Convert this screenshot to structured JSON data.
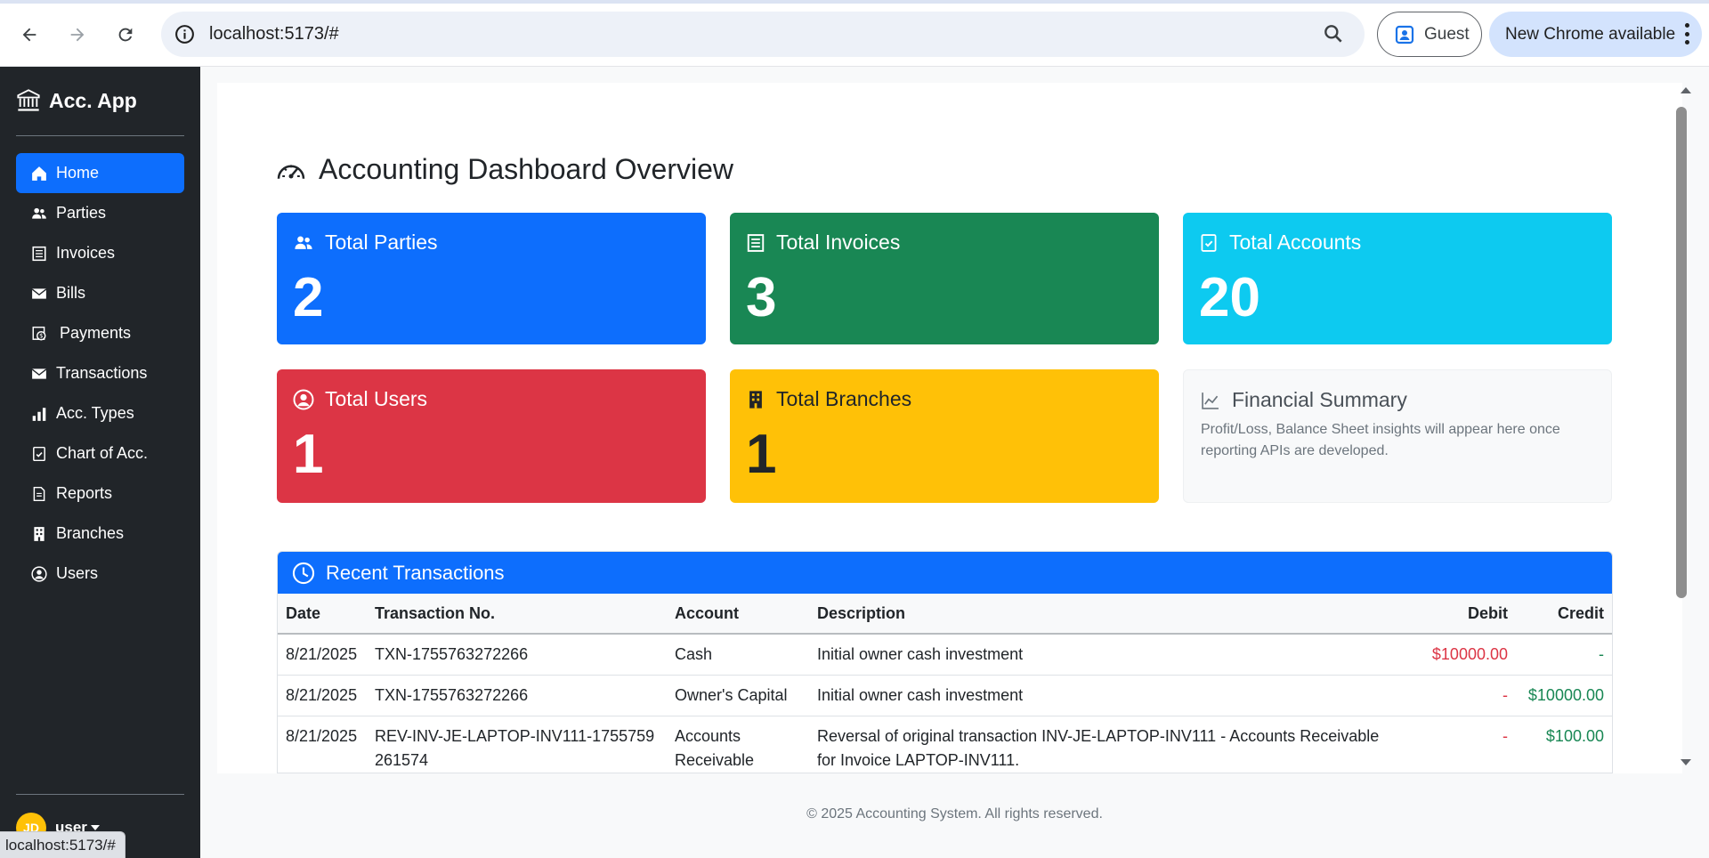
{
  "browser": {
    "url": "localhost:5173/#",
    "profile_label": "Guest",
    "update_label": "New Chrome available",
    "status_url": "localhost:5173/#"
  },
  "sidebar": {
    "brand": "Acc. App",
    "items": [
      {
        "label": "Home",
        "icon": "home-icon"
      },
      {
        "label": "Parties",
        "icon": "people-icon"
      },
      {
        "label": "Invoices",
        "icon": "invoice-icon"
      },
      {
        "label": "Bills",
        "icon": "envelope-icon"
      },
      {
        "label": "Payments",
        "icon": "cash-icon"
      },
      {
        "label": "Transactions",
        "icon": "envelope-icon"
      },
      {
        "label": "Acc. Types",
        "icon": "bar-chart-icon"
      },
      {
        "label": "Chart of Acc.",
        "icon": "journal-check-icon"
      },
      {
        "label": "Reports",
        "icon": "document-icon"
      },
      {
        "label": "Branches",
        "icon": "building-icon"
      },
      {
        "label": "Users",
        "icon": "user-circle-icon"
      }
    ],
    "user_initials": "JD",
    "user_name": "user"
  },
  "dashboard": {
    "title": "Accounting Dashboard Overview",
    "cards": {
      "parties": {
        "label": "Total Parties",
        "value": "2"
      },
      "invoices": {
        "label": "Total Invoices",
        "value": "3"
      },
      "accounts": {
        "label": "Total Accounts",
        "value": "20"
      },
      "users": {
        "label": "Total Users",
        "value": "1"
      },
      "branches": {
        "label": "Total Branches",
        "value": "1"
      },
      "summary": {
        "label": "Financial Summary",
        "text": "Profit/Loss, Balance Sheet insights will appear here once reporting APIs are developed."
      }
    },
    "recent": {
      "title": "Recent Transactions",
      "columns": [
        "Date",
        "Transaction No.",
        "Account",
        "Description",
        "Debit",
        "Credit"
      ],
      "rows": [
        {
          "date": "8/21/2025",
          "txn": "TXN-1755763272266",
          "account": "Cash",
          "description": "Initial owner cash investment",
          "debit": "$10000.00",
          "credit": "-"
        },
        {
          "date": "8/21/2025",
          "txn": "TXN-1755763272266",
          "account": "Owner's Capital",
          "description": "Initial owner cash investment",
          "debit": "-",
          "credit": "$10000.00"
        },
        {
          "date": "8/21/2025",
          "txn": "REV-INV-JE-LAPTOP-INV111-1755759261574",
          "account": "Accounts Receivable",
          "description": "Reversal of original transaction INV-JE-LAPTOP-INV111 - Accounts Receivable for Invoice LAPTOP-INV111.",
          "debit": "-",
          "credit": "$100.00"
        }
      ]
    },
    "footer": "© 2025 Accounting System. All rights reserved."
  },
  "colors": {
    "primary": "#0d6efd",
    "success": "#198754",
    "info": "#0dcaf0",
    "danger": "#dc3545",
    "warning": "#ffc107",
    "sidebar": "#212529"
  }
}
